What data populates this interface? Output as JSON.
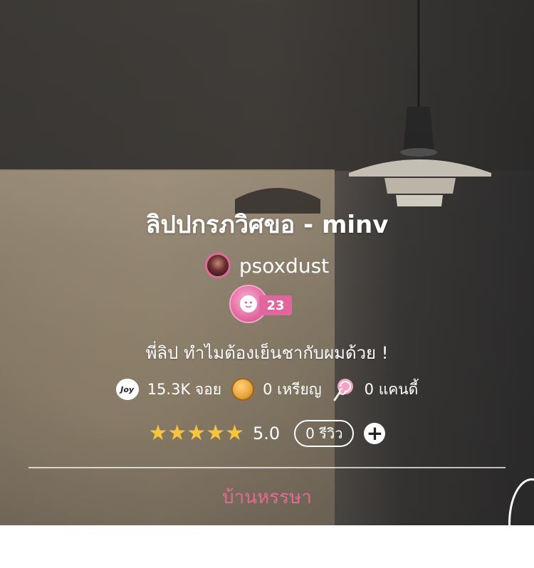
{
  "story": {
    "title": "ลิปปกรภวิศขอ - minv",
    "author": "psoxdust",
    "level": "23",
    "tagline": "พี่ลิป ทำไมต้องเย็นชากับผมด้วย !",
    "category": "บ้านหรรษา"
  },
  "stats": {
    "joy_icon_text": "Joy",
    "joy": "15.3K จอย",
    "coins": "0 เหรียญ",
    "candy": "0 แคนดี้"
  },
  "rating": {
    "stars": "★★★★★",
    "score": "5.0",
    "reviews_label": "0 รีวิว",
    "add_symbol": "+"
  },
  "icons": {
    "joy": "joy-badge-icon",
    "coin": "coin-icon",
    "candy": "lollipop-icon",
    "add": "plus-circle-icon"
  },
  "colors": {
    "accent_pink": "#e46a95",
    "star": "#f5c63c",
    "level_badge": "#e2669e"
  }
}
